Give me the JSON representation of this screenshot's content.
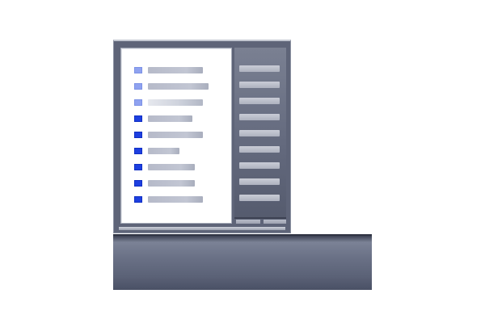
{
  "window": {
    "left_pane": {
      "items": [
        {
          "icon": "folder-icon",
          "state": "light"
        },
        {
          "icon": "folder-icon",
          "state": "light"
        },
        {
          "icon": "folder-icon",
          "state": "light"
        },
        {
          "icon": "folder-icon",
          "state": "dark"
        },
        {
          "icon": "folder-icon",
          "state": "dark"
        },
        {
          "icon": "folder-icon",
          "state": "dark"
        },
        {
          "icon": "folder-icon",
          "state": "dark"
        },
        {
          "icon": "folder-icon",
          "state": "dark"
        },
        {
          "icon": "folder-icon",
          "state": "dark"
        }
      ]
    },
    "right_pane": {
      "item_count": 9,
      "tab_count": 2
    }
  },
  "colors": {
    "icon_light": "#8fa2f0",
    "icon_dark": "#1d3fe0",
    "chrome": "#5e6478"
  }
}
